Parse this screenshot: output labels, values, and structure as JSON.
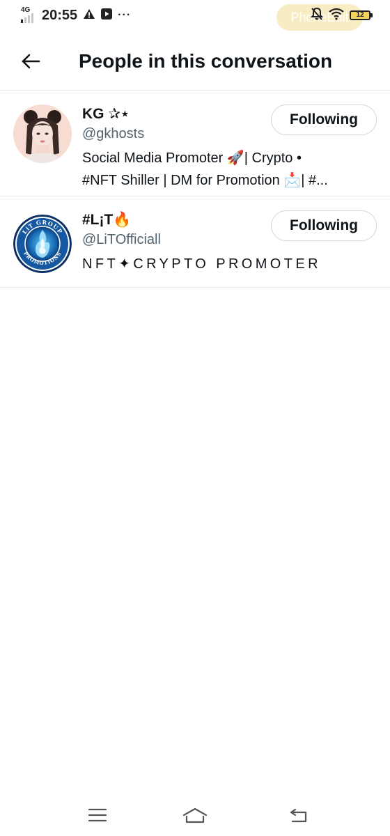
{
  "status_bar": {
    "network": "4G",
    "time": "20:55",
    "more": "···",
    "overlay_label": "PhoneEdit",
    "battery_level": "12",
    "battery_color": "#f3d35c",
    "left_icons": [
      "signal-icon",
      "warning-icon",
      "youtube-icon"
    ],
    "right_icons": [
      "mute-bell-icon",
      "wifi-icon",
      "battery-icon"
    ]
  },
  "header": {
    "back_icon": "back-arrow-icon",
    "title": "People in this conversation"
  },
  "users": [
    {
      "display_name": "KG ✰⋆",
      "handle": "@gkhosts",
      "bio_lines": [
        "Social Media Promoter 🚀| Crypto •",
        "#NFT Shiller | DM for Promotion 📩| #..."
      ],
      "button_label": "Following",
      "avatar": "profile-photo"
    },
    {
      "display_name": "#L¡T🔥",
      "handle": "@LiTOfficiall",
      "bio_lines": [
        "NFT✦CRYPTO PROMOTER"
      ],
      "button_label": "Following",
      "avatar": "lit-group-promotions-logo",
      "avatar_text": "LiT GROUP PROMOTIONS"
    }
  ],
  "nav_bar": {
    "icons": [
      "menu-icon",
      "home-icon",
      "back-icon"
    ]
  },
  "colors": {
    "text_primary": "#0f1419",
    "text_secondary": "#536471",
    "divider": "#e1e8ed",
    "button_border": "#cfd9de",
    "overlay_pill": "#f8ecc2"
  }
}
